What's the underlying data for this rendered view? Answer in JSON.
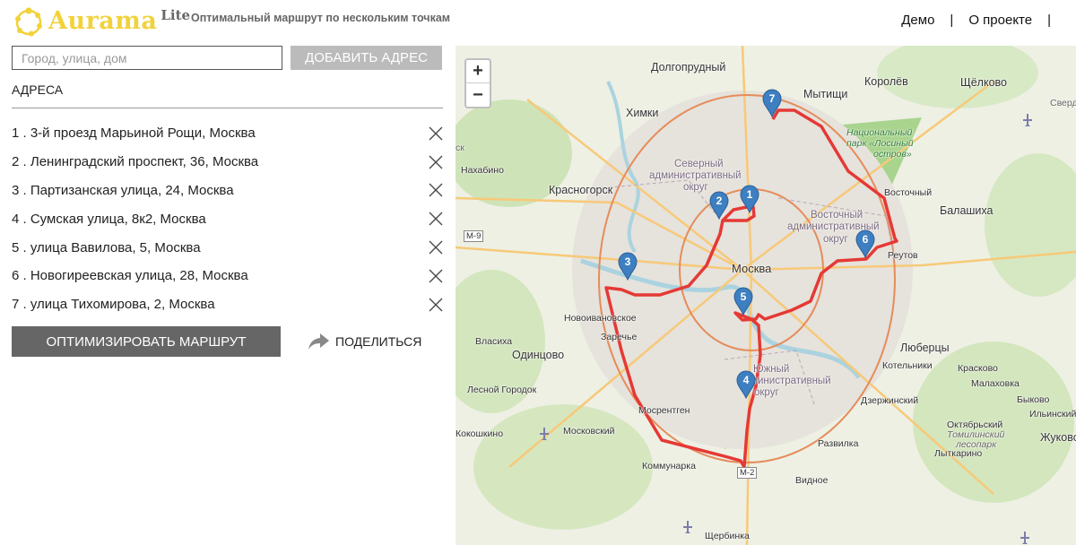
{
  "header": {
    "logo_text": "Aurama",
    "logo_suffix": "Lite",
    "tagline": "Оптимальный маршрут по нескольким точкам",
    "nav": [
      {
        "label": "Демо"
      },
      {
        "label": "|"
      },
      {
        "label": "О проекте"
      },
      {
        "label": "|"
      }
    ]
  },
  "panel": {
    "input_placeholder": "Город, улица, дом",
    "add_button": "ДОБАВИТЬ АДРЕС",
    "heading": "АДРЕСА",
    "addresses": [
      "1 . 3-й проезд Марьиной Рощи, Москва",
      "2 . Ленинградский проспект, 36, Москва",
      "3 . Партизанская улица, 24, Москва",
      "4 . Сумская улица, 8к2, Москва",
      "5 . улица Вавилова, 5, Москва",
      "6 . Новогиреевская улица, 28, Москва",
      "7 . улица Тихомирова, 2, Москва"
    ],
    "optimize_button": "ОПТИМИЗИРОВАТЬ МАРШРУТ",
    "share_label": "ПОДЕЛИТЬСЯ"
  },
  "map": {
    "zoom_in": "+",
    "zoom_out": "−",
    "markers": [
      "1",
      "2",
      "3",
      "4",
      "5",
      "6",
      "7"
    ],
    "labels": {
      "dolgoprudny": "Долгопрудный",
      "mytishchi": "Мытищи",
      "korolev": "Королёв",
      "shchelkovo": "Щёлково",
      "sverdl": "Свердл",
      "khimki": "Химки",
      "nat_park": "Национальный",
      "nat_park2": "парк «Лосиный",
      "nat_park3": "остров»",
      "nakhabino": "Нахабино",
      "severny": "Северный",
      "severny2": "административный",
      "severny3": "округ",
      "krasnogorsk": "Красногорск",
      "vostochny_s": "Восточный",
      "balashikha": "Балашиха",
      "vostochny": "Восточный",
      "vostochny2": "административный",
      "vostochny3": "округ",
      "m9": "М-9",
      "reutov": "Реутов",
      "moskva": "Москва",
      "novoivankovskoe": "Новоивановское",
      "zarechye": "Заречье",
      "vlasikha": "Власиха",
      "odintsovo": "Одинцово",
      "lyubertsy": "Люберцы",
      "kotelniki": "Котельники",
      "krasnovo": "Красково",
      "yuzhny": "Южный",
      "yuzhny2": "административный",
      "yuzhny3": "округ",
      "malakhovka": "Малаховка",
      "lesnoy": "Лесной Городок",
      "dzerzhinsky": "Дзержинский",
      "bykovo": "Быково",
      "mosrentgen": "Мосрентген",
      "ilyinsky": "Ильинский",
      "oktyabrsky": "Октябрьский",
      "tomilinsky": "Томилинский",
      "tomilinsky2": "лесопарк",
      "kokoshkino": "Кокошкино",
      "moskovsky": "Московский",
      "zhukovsky": "Жуковс",
      "razvilka": "Развилка",
      "lytkarino": "Лыткарино",
      "kommunarka": "Коммунарка",
      "m2": "М-2",
      "vidnoe": "Видное",
      "shcherbinka": "Щербинка",
      "sk": "ск"
    }
  }
}
